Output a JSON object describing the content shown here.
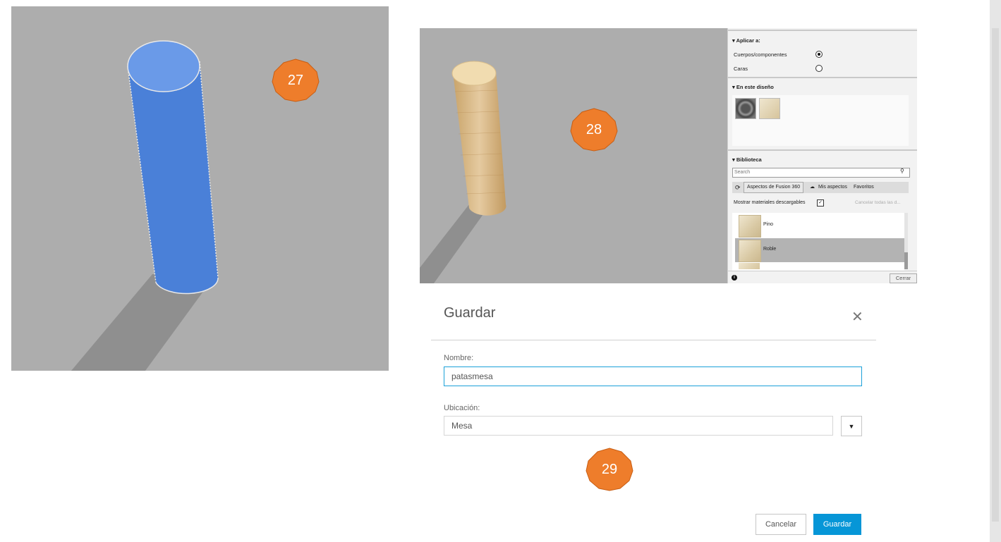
{
  "badges": {
    "b27": "27",
    "b28": "28",
    "b29": "29"
  },
  "colors": {
    "badge": "#ee7d2b",
    "accent": "#0696d7",
    "cylinder_blue": "#4a80d8",
    "viewport_bg": "#adadad"
  },
  "material_panel": {
    "apply_to": {
      "heading": "Aplicar a:",
      "options": [
        {
          "label": "Cuerpos/componentes",
          "selected": true
        },
        {
          "label": "Caras",
          "selected": false
        }
      ]
    },
    "in_design": {
      "heading": "En este diseño"
    },
    "library": {
      "heading": "Biblioteca",
      "search_placeholder": "Search",
      "tabs": [
        "Aspectos de Fusion 360",
        "Mis aspectos",
        "Favoritos"
      ],
      "show_downloadable_label": "Mostrar materiales descargables",
      "show_downloadable_checked": true,
      "cancel_all_label": "Cancelar todas las d...",
      "items": [
        "Pino",
        "Roble"
      ]
    },
    "close_label": "Cerrar"
  },
  "save_dialog": {
    "title": "Guardar",
    "name_label": "Nombre:",
    "name_value": "patasmesa",
    "location_label": "Ubicación:",
    "location_value": "Mesa",
    "cancel_label": "Cancelar",
    "save_label": "Guardar"
  }
}
